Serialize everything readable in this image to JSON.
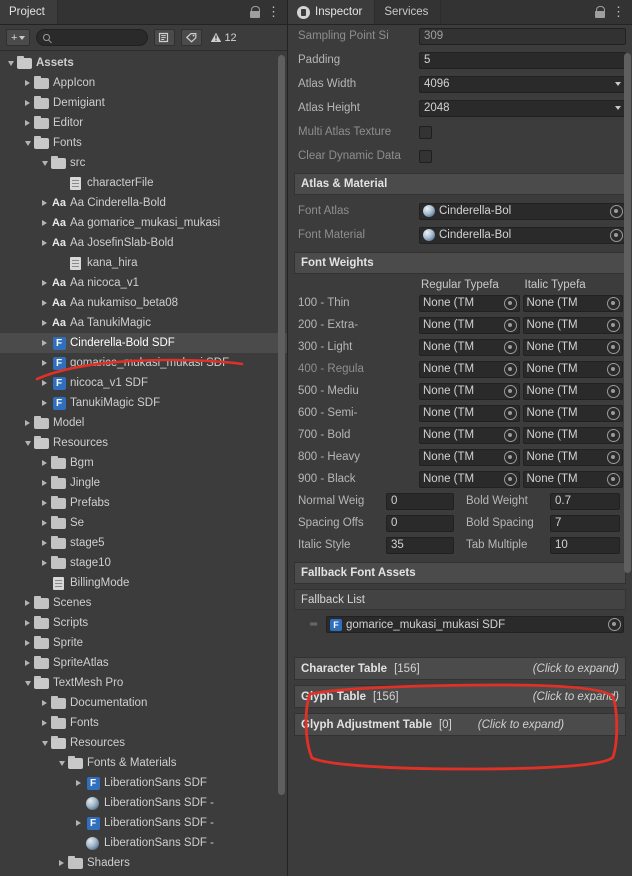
{
  "project_panel": {
    "tab_label": "Project",
    "toolbar": {
      "add_label": "+",
      "search_placeholder": "",
      "search_value": "",
      "warning_count": "12"
    },
    "tree": [
      {
        "label": "Assets",
        "depth": 0,
        "arrow": "down",
        "icon": "folder",
        "bold": true
      },
      {
        "label": "AppIcon",
        "depth": 1,
        "arrow": "right",
        "icon": "folder"
      },
      {
        "label": "Demigiant",
        "depth": 1,
        "arrow": "right",
        "icon": "folder"
      },
      {
        "label": "Editor",
        "depth": 1,
        "arrow": "right",
        "icon": "folder"
      },
      {
        "label": "Fonts",
        "depth": 1,
        "arrow": "down",
        "icon": "folder"
      },
      {
        "label": "src",
        "depth": 2,
        "arrow": "down",
        "icon": "folder"
      },
      {
        "label": "characterFile",
        "depth": 3,
        "arrow": "none",
        "icon": "file"
      },
      {
        "label": "Aa Cinderella-Bold",
        "depth": 2,
        "arrow": "right",
        "icon": "aa"
      },
      {
        "label": "Aa gomarice_mukasi_mukasi",
        "depth": 2,
        "arrow": "right",
        "icon": "aa"
      },
      {
        "label": "Aa JosefinSlab-Bold",
        "depth": 2,
        "arrow": "right",
        "icon": "aa"
      },
      {
        "label": "kana_hira",
        "depth": 3,
        "arrow": "none",
        "icon": "file"
      },
      {
        "label": "Aa nicoca_v1",
        "depth": 2,
        "arrow": "right",
        "icon": "aa"
      },
      {
        "label": "Aa nukamiso_beta08",
        "depth": 2,
        "arrow": "right",
        "icon": "aa"
      },
      {
        "label": "Aa TanukiMagic",
        "depth": 2,
        "arrow": "right",
        "icon": "aa"
      },
      {
        "label": "Cinderella-Bold SDF",
        "depth": 2,
        "arrow": "right",
        "icon": "tmp",
        "selected": true
      },
      {
        "label": "gomarice_mukasi_mukasi SDF",
        "depth": 2,
        "arrow": "right",
        "icon": "tmp"
      },
      {
        "label": "nicoca_v1 SDF",
        "depth": 2,
        "arrow": "right",
        "icon": "tmp"
      },
      {
        "label": "TanukiMagic SDF",
        "depth": 2,
        "arrow": "right",
        "icon": "tmp"
      },
      {
        "label": "Model",
        "depth": 1,
        "arrow": "right",
        "icon": "folder"
      },
      {
        "label": "Resources",
        "depth": 1,
        "arrow": "down",
        "icon": "folder"
      },
      {
        "label": "Bgm",
        "depth": 2,
        "arrow": "right",
        "icon": "folder"
      },
      {
        "label": "Jingle",
        "depth": 2,
        "arrow": "right",
        "icon": "folder"
      },
      {
        "label": "Prefabs",
        "depth": 2,
        "arrow": "right",
        "icon": "folder"
      },
      {
        "label": "Se",
        "depth": 2,
        "arrow": "right",
        "icon": "folder"
      },
      {
        "label": "stage5",
        "depth": 2,
        "arrow": "right",
        "icon": "folder"
      },
      {
        "label": "stage10",
        "depth": 2,
        "arrow": "right",
        "icon": "folder"
      },
      {
        "label": "BillingMode",
        "depth": 2,
        "arrow": "none",
        "icon": "file"
      },
      {
        "label": "Scenes",
        "depth": 1,
        "arrow": "right",
        "icon": "folder"
      },
      {
        "label": "Scripts",
        "depth": 1,
        "arrow": "right",
        "icon": "folder"
      },
      {
        "label": "Sprite",
        "depth": 1,
        "arrow": "right",
        "icon": "folder"
      },
      {
        "label": "SpriteAtlas",
        "depth": 1,
        "arrow": "right",
        "icon": "folder"
      },
      {
        "label": "TextMesh Pro",
        "depth": 1,
        "arrow": "down",
        "icon": "folder"
      },
      {
        "label": "Documentation",
        "depth": 2,
        "arrow": "right",
        "icon": "folder"
      },
      {
        "label": "Fonts",
        "depth": 2,
        "arrow": "right",
        "icon": "folder"
      },
      {
        "label": "Resources",
        "depth": 2,
        "arrow": "down",
        "icon": "folder"
      },
      {
        "label": "Fonts & Materials",
        "depth": 3,
        "arrow": "down",
        "icon": "folder"
      },
      {
        "label": "LiberationSans SDF",
        "depth": 4,
        "arrow": "right",
        "icon": "tmp"
      },
      {
        "label": "LiberationSans SDF -",
        "depth": 4,
        "arrow": "none",
        "icon": "mat"
      },
      {
        "label": "LiberationSans SDF -",
        "depth": 4,
        "arrow": "right",
        "icon": "tmp"
      },
      {
        "label": "LiberationSans SDF -",
        "depth": 4,
        "arrow": "none",
        "icon": "mat"
      },
      {
        "label": "Shaders",
        "depth": 3,
        "arrow": "right",
        "icon": "folder"
      }
    ]
  },
  "inspector": {
    "tabs": [
      {
        "label": "Inspector",
        "active": true,
        "icon": "inspector-icon"
      },
      {
        "label": "Services",
        "active": false
      }
    ],
    "top_fields": [
      {
        "label": "Sampling Point Si",
        "value": "309",
        "type": "text",
        "dim": true
      },
      {
        "label": "Padding",
        "value": "5",
        "type": "text"
      },
      {
        "label": "Atlas Width",
        "value": "4096",
        "type": "dropdown"
      },
      {
        "label": "Atlas Height",
        "value": "2048",
        "type": "dropdown"
      },
      {
        "label": "Multi Atlas Texture",
        "value": "",
        "type": "checkbox",
        "dim": true
      },
      {
        "label": "Clear Dynamic Data",
        "value": "",
        "type": "checkbox",
        "dim": true
      }
    ],
    "atlas_material": {
      "header": "Atlas & Material",
      "rows": [
        {
          "label": "Font Atlas",
          "value": "Cinderella-Bol",
          "icon": "texture-icon"
        },
        {
          "label": "Font Material",
          "value": "Cinderella-Bol",
          "icon": "material-icon"
        }
      ]
    },
    "font_weights": {
      "header": "Font Weights",
      "col_regular": "Regular Typefa",
      "col_italic": "Italic Typefa",
      "rows": [
        {
          "weight": "100 - Thin",
          "regular": "None (TM",
          "italic": "None (TM"
        },
        {
          "weight": "200 - Extra-",
          "regular": "None (TM",
          "italic": "None (TM"
        },
        {
          "weight": "300 - Light",
          "regular": "None (TM",
          "italic": "None (TM"
        },
        {
          "weight": "400 - Regula",
          "regular": "None (TM",
          "italic": "None (TM",
          "dim": true
        },
        {
          "weight": "500 - Mediu",
          "regular": "None (TM",
          "italic": "None (TM"
        },
        {
          "weight": "600 - Semi-",
          "regular": "None (TM",
          "italic": "None (TM"
        },
        {
          "weight": "700 - Bold",
          "regular": "None (TM",
          "italic": "None (TM"
        },
        {
          "weight": "800 - Heavy",
          "regular": "None (TM",
          "italic": "None (TM"
        },
        {
          "weight": "900 - Black",
          "regular": "None (TM",
          "italic": "None (TM"
        }
      ]
    },
    "weight_params": [
      {
        "label_left": "Normal Weig",
        "value_left": "0",
        "label_right": "Bold Weight",
        "value_right": "0.7"
      },
      {
        "label_left": "Spacing Offs",
        "value_left": "0",
        "label_right": "Bold Spacing",
        "value_right": "7"
      },
      {
        "label_left": "Italic Style",
        "value_left": "35",
        "label_right": "Tab Multiple",
        "value_right": "10"
      }
    ],
    "fallback": {
      "header": "Fallback Font Assets",
      "list_label": "Fallback List",
      "items": [
        {
          "value": "gomarice_mukasi_mukasi SDF",
          "icon": "tmp-font-icon"
        }
      ]
    },
    "expandables": [
      {
        "title": "Character Table",
        "count": "[156]",
        "hint": "(Click to expand)"
      },
      {
        "title": "Glyph Table",
        "count": "[156]",
        "hint": "(Click to expand)"
      },
      {
        "title": "Glyph Adjustment Table",
        "count": "[0]",
        "hint": "(Click to expand)"
      }
    ]
  },
  "annotations": {
    "color": "#e03127",
    "marks": [
      "underline-selected-font-asset",
      "box-around-fallback-font-assets"
    ]
  }
}
